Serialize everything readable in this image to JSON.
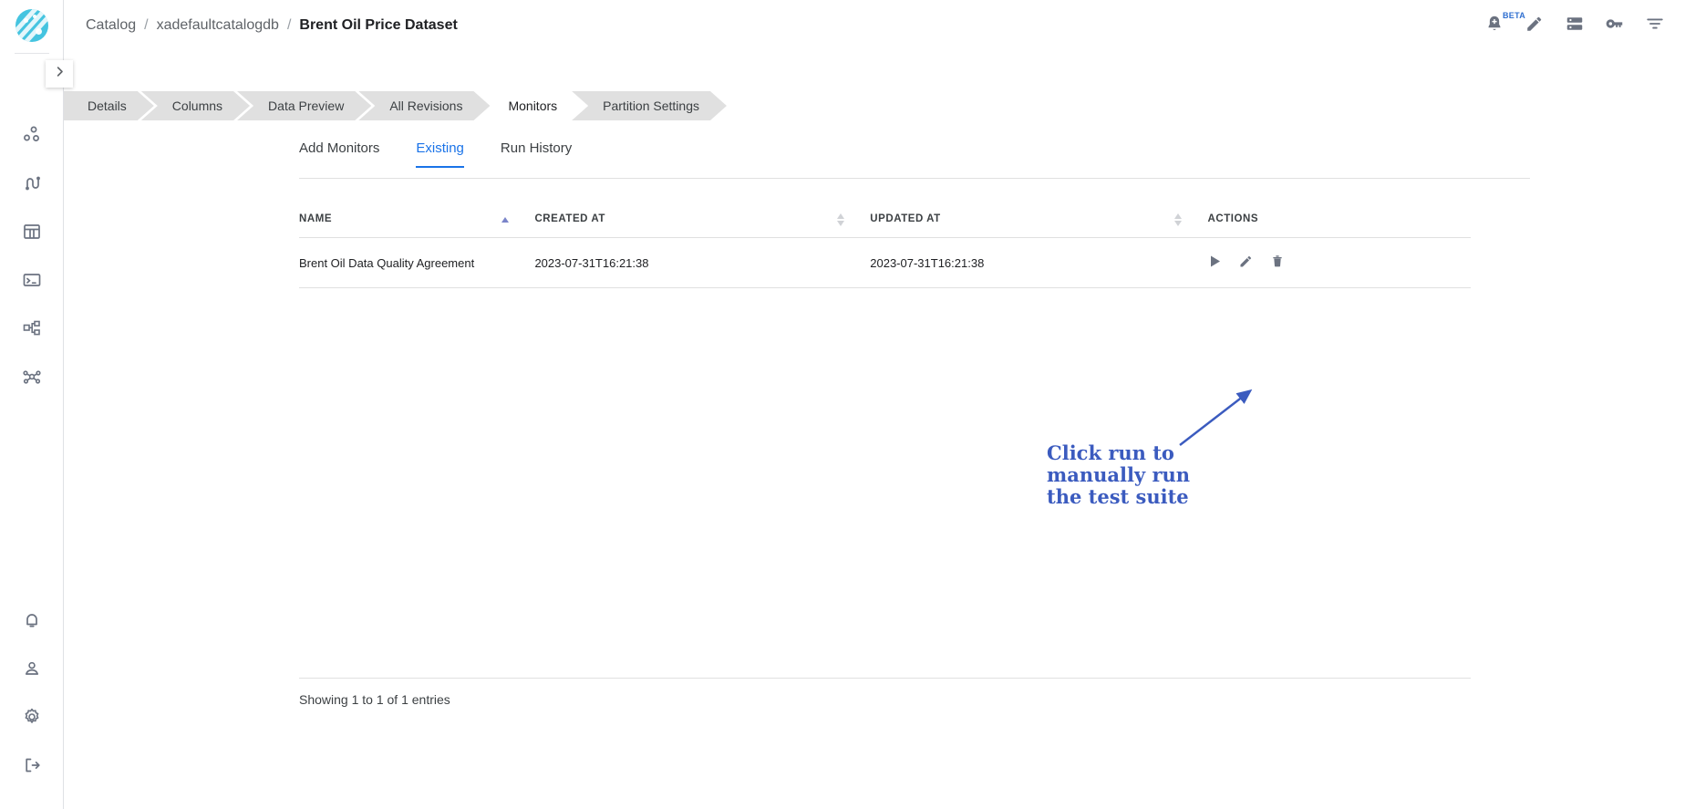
{
  "app": {
    "logo_name": "app-logo"
  },
  "header": {
    "breadcrumb": [
      {
        "label": "Catalog",
        "active": false
      },
      {
        "label": "xadefaultcatalogdb",
        "active": false
      },
      {
        "label": "Brent Oil Price Dataset",
        "active": true
      }
    ],
    "separator": "/",
    "actions": [
      {
        "name": "notifications-beta-button",
        "icon": "bell-plus-icon",
        "badge": "BETA"
      },
      {
        "name": "edit-button",
        "icon": "pencil-icon",
        "badge": ""
      },
      {
        "name": "server-button",
        "icon": "server-icon",
        "badge": ""
      },
      {
        "name": "permissions-button",
        "icon": "key-icon",
        "badge": ""
      },
      {
        "name": "filter-button",
        "icon": "filter-icon",
        "badge": ""
      }
    ]
  },
  "sidebar": {
    "expand_icon": "chevron-right-icon",
    "top_items": [
      {
        "name": "sidebar-item-clusters",
        "icon": "cluster-dots-icon"
      },
      {
        "name": "sidebar-item-pipelines",
        "icon": "pipeline-flow-icon"
      },
      {
        "name": "sidebar-item-catalog",
        "icon": "table-icon"
      },
      {
        "name": "sidebar-item-console",
        "icon": "terminal-icon"
      },
      {
        "name": "sidebar-item-workflows",
        "icon": "hierarchy-icon"
      },
      {
        "name": "sidebar-item-lineage",
        "icon": "network-graph-icon"
      }
    ],
    "bottom_items": [
      {
        "name": "sidebar-item-notifications",
        "icon": "bell-icon"
      },
      {
        "name": "sidebar-item-profile",
        "icon": "user-icon"
      },
      {
        "name": "sidebar-item-settings",
        "icon": "gear-icon"
      },
      {
        "name": "sidebar-item-logout",
        "icon": "logout-icon"
      }
    ]
  },
  "tabs": [
    {
      "label": "Details",
      "active": false
    },
    {
      "label": "Columns",
      "active": false
    },
    {
      "label": "Data Preview",
      "active": false
    },
    {
      "label": "All Revisions",
      "active": false
    },
    {
      "label": "Monitors",
      "active": true
    },
    {
      "label": "Partition Settings",
      "active": false
    }
  ],
  "subtabs": [
    {
      "label": "Add Monitors",
      "active": false
    },
    {
      "label": "Existing",
      "active": true
    },
    {
      "label": "Run History",
      "active": false
    }
  ],
  "table": {
    "columns": [
      {
        "label": "NAME",
        "sort": "asc"
      },
      {
        "label": "CREATED AT",
        "sort": "none"
      },
      {
        "label": "UPDATED AT",
        "sort": "none"
      },
      {
        "label": "ACTIONS",
        "sort": ""
      }
    ],
    "rows": [
      {
        "name": "Brent Oil Data Quality Agreement",
        "created_at": "2023-07-31T16:21:38",
        "updated_at": "2023-07-31T16:21:38",
        "actions": [
          {
            "name": "run-monitor-button",
            "icon": "play-icon"
          },
          {
            "name": "edit-monitor-button",
            "icon": "pencil-icon"
          },
          {
            "name": "delete-monitor-button",
            "icon": "trash-icon"
          }
        ]
      }
    ],
    "footer": "Showing 1 to 1 of 1 entries"
  },
  "annotation": {
    "text": "Click run to\nmanually run\nthe test suite",
    "color": "#3b5bbf"
  }
}
